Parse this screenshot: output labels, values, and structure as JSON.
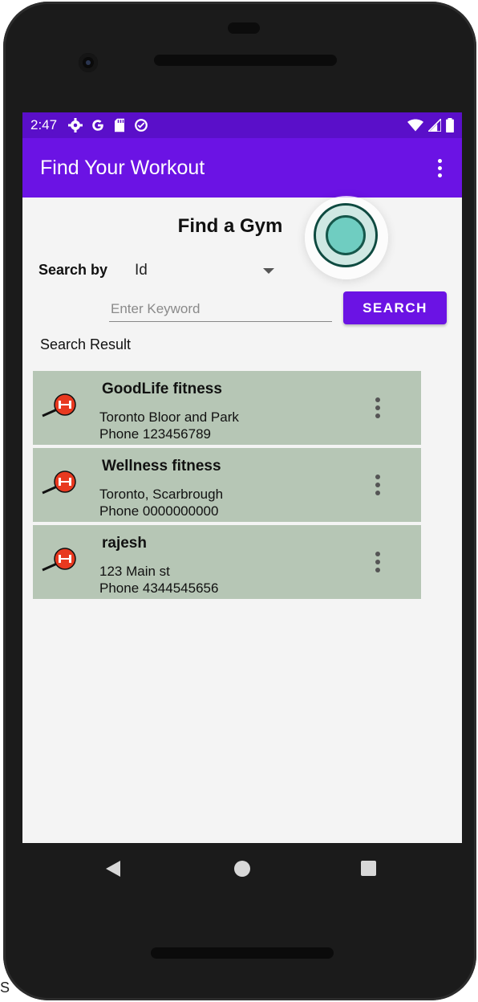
{
  "status_bar": {
    "time": "2:47"
  },
  "app_bar": {
    "title": "Find Your Workout"
  },
  "page": {
    "title": "Find a Gym"
  },
  "search": {
    "label": "Search by",
    "selected_option": "Id",
    "keyword_placeholder": "Enter Keyword",
    "keyword_value": "",
    "button_label": "SEARCH"
  },
  "results": {
    "label": "Search Result",
    "items": [
      {
        "name": "GoodLife fitness",
        "address": "Toronto Bloor and Park",
        "phone": "Phone  123456789"
      },
      {
        "name": "Wellness fitness",
        "address": "Toronto, Scarbrough",
        "phone": "Phone  0000000000"
      },
      {
        "name": "rajesh",
        "address": "123 Main st",
        "phone": "Phone  4344545656"
      }
    ]
  },
  "edge_text": "S",
  "colors": {
    "status_bar": "#5a0fc9",
    "app_bar": "#6b13e4",
    "accent_button": "#6b13e4",
    "result_item_bg": "#b6c6b5",
    "fab_fill": "#6fcdc1"
  },
  "icons": [
    "settings-icon",
    "google-icon",
    "sd-card-icon",
    "data-saver-icon",
    "wifi-icon",
    "signal-icon",
    "battery-icon",
    "overflow-menu-icon",
    "gym-logo-icon",
    "back-icon",
    "home-icon",
    "recents-icon"
  ]
}
